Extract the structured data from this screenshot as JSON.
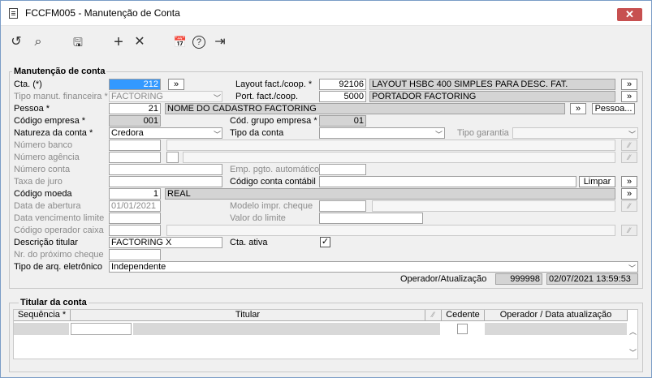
{
  "window": {
    "title": "FCCFM005 - Manutenção de Conta",
    "close": "✕"
  },
  "toolbar": {
    "undo": "↺",
    "search": "⌕",
    "save": "🖫",
    "add": "+",
    "delete": "✕",
    "calendar": "📅",
    "help": "?",
    "exit": "⇥"
  },
  "form": {
    "section_title": "Manutenção de conta",
    "cta_label": "Cta. (*)",
    "cta_value": "212",
    "tipo_manut_label": "Tipo manut. financeira *",
    "tipo_manut_value": "FACTORING",
    "pessoa_label": "Pessoa *",
    "pessoa_value": "21",
    "pessoa_name": "NOME DO CADASTRO FACTORING",
    "pessoa_btn": "Pessoa...",
    "codigo_empresa_label": "Código empresa *",
    "codigo_empresa_value": "001",
    "natureza_label": "Natureza da conta *",
    "natureza_value": "Credora",
    "numero_banco_label": "Número banco",
    "numero_agencia_label": "Número agência",
    "numero_conta_label": "Número conta",
    "taxa_juro_label": "Taxa de juro",
    "codigo_moeda_label": "Código moeda",
    "codigo_moeda_value": "1",
    "moeda_name": "REAL",
    "data_abertura_label": "Data de abertura",
    "data_abertura_value": "01/01/2021",
    "data_venc_label": "Data vencimento limite",
    "codigo_operador_label": "Código operador caixa",
    "descricao_label": "Descrição titular",
    "descricao_value": "FACTORING X",
    "nr_cheque_label": "Nr. do próximo cheque",
    "tipo_arq_label": "Tipo de arq. eletrônico",
    "tipo_arq_value": "Independente",
    "layout_label": "Layout fact./coop. *",
    "layout_value": "92106",
    "layout_name": "LAYOUT HSBC 400 SIMPLES PARA DESC. FAT.",
    "port_label": "Port. fact./coop.",
    "port_value": "5000",
    "port_name": "PORTADOR FACTORING",
    "cod_grupo_label": "Cód. grupo empresa *",
    "cod_grupo_value": "01",
    "tipo_conta_label": "Tipo da conta",
    "tipo_garantia_label": "Tipo garantia",
    "emp_pgto_label": "Emp. pgto. automático",
    "conta_contabil_label": "Código conta contábil",
    "limpar_btn": "Limpar",
    "modelo_cheque_label": "Modelo impr. cheque",
    "valor_limite_label": "Valor do limite",
    "cta_ativa_label": "Cta. ativa",
    "operador_label": "Operador/Atualização",
    "operador_value": "999998",
    "atualizacao_value": "02/07/2021 13:59:53",
    "nav_btn": "»"
  },
  "titular": {
    "section_title": "Titular da conta",
    "col_sequencia": "Sequência *",
    "col_titular": "Titular",
    "col_cedente": "Cedente",
    "col_operador": "Operador / Data atualização"
  }
}
